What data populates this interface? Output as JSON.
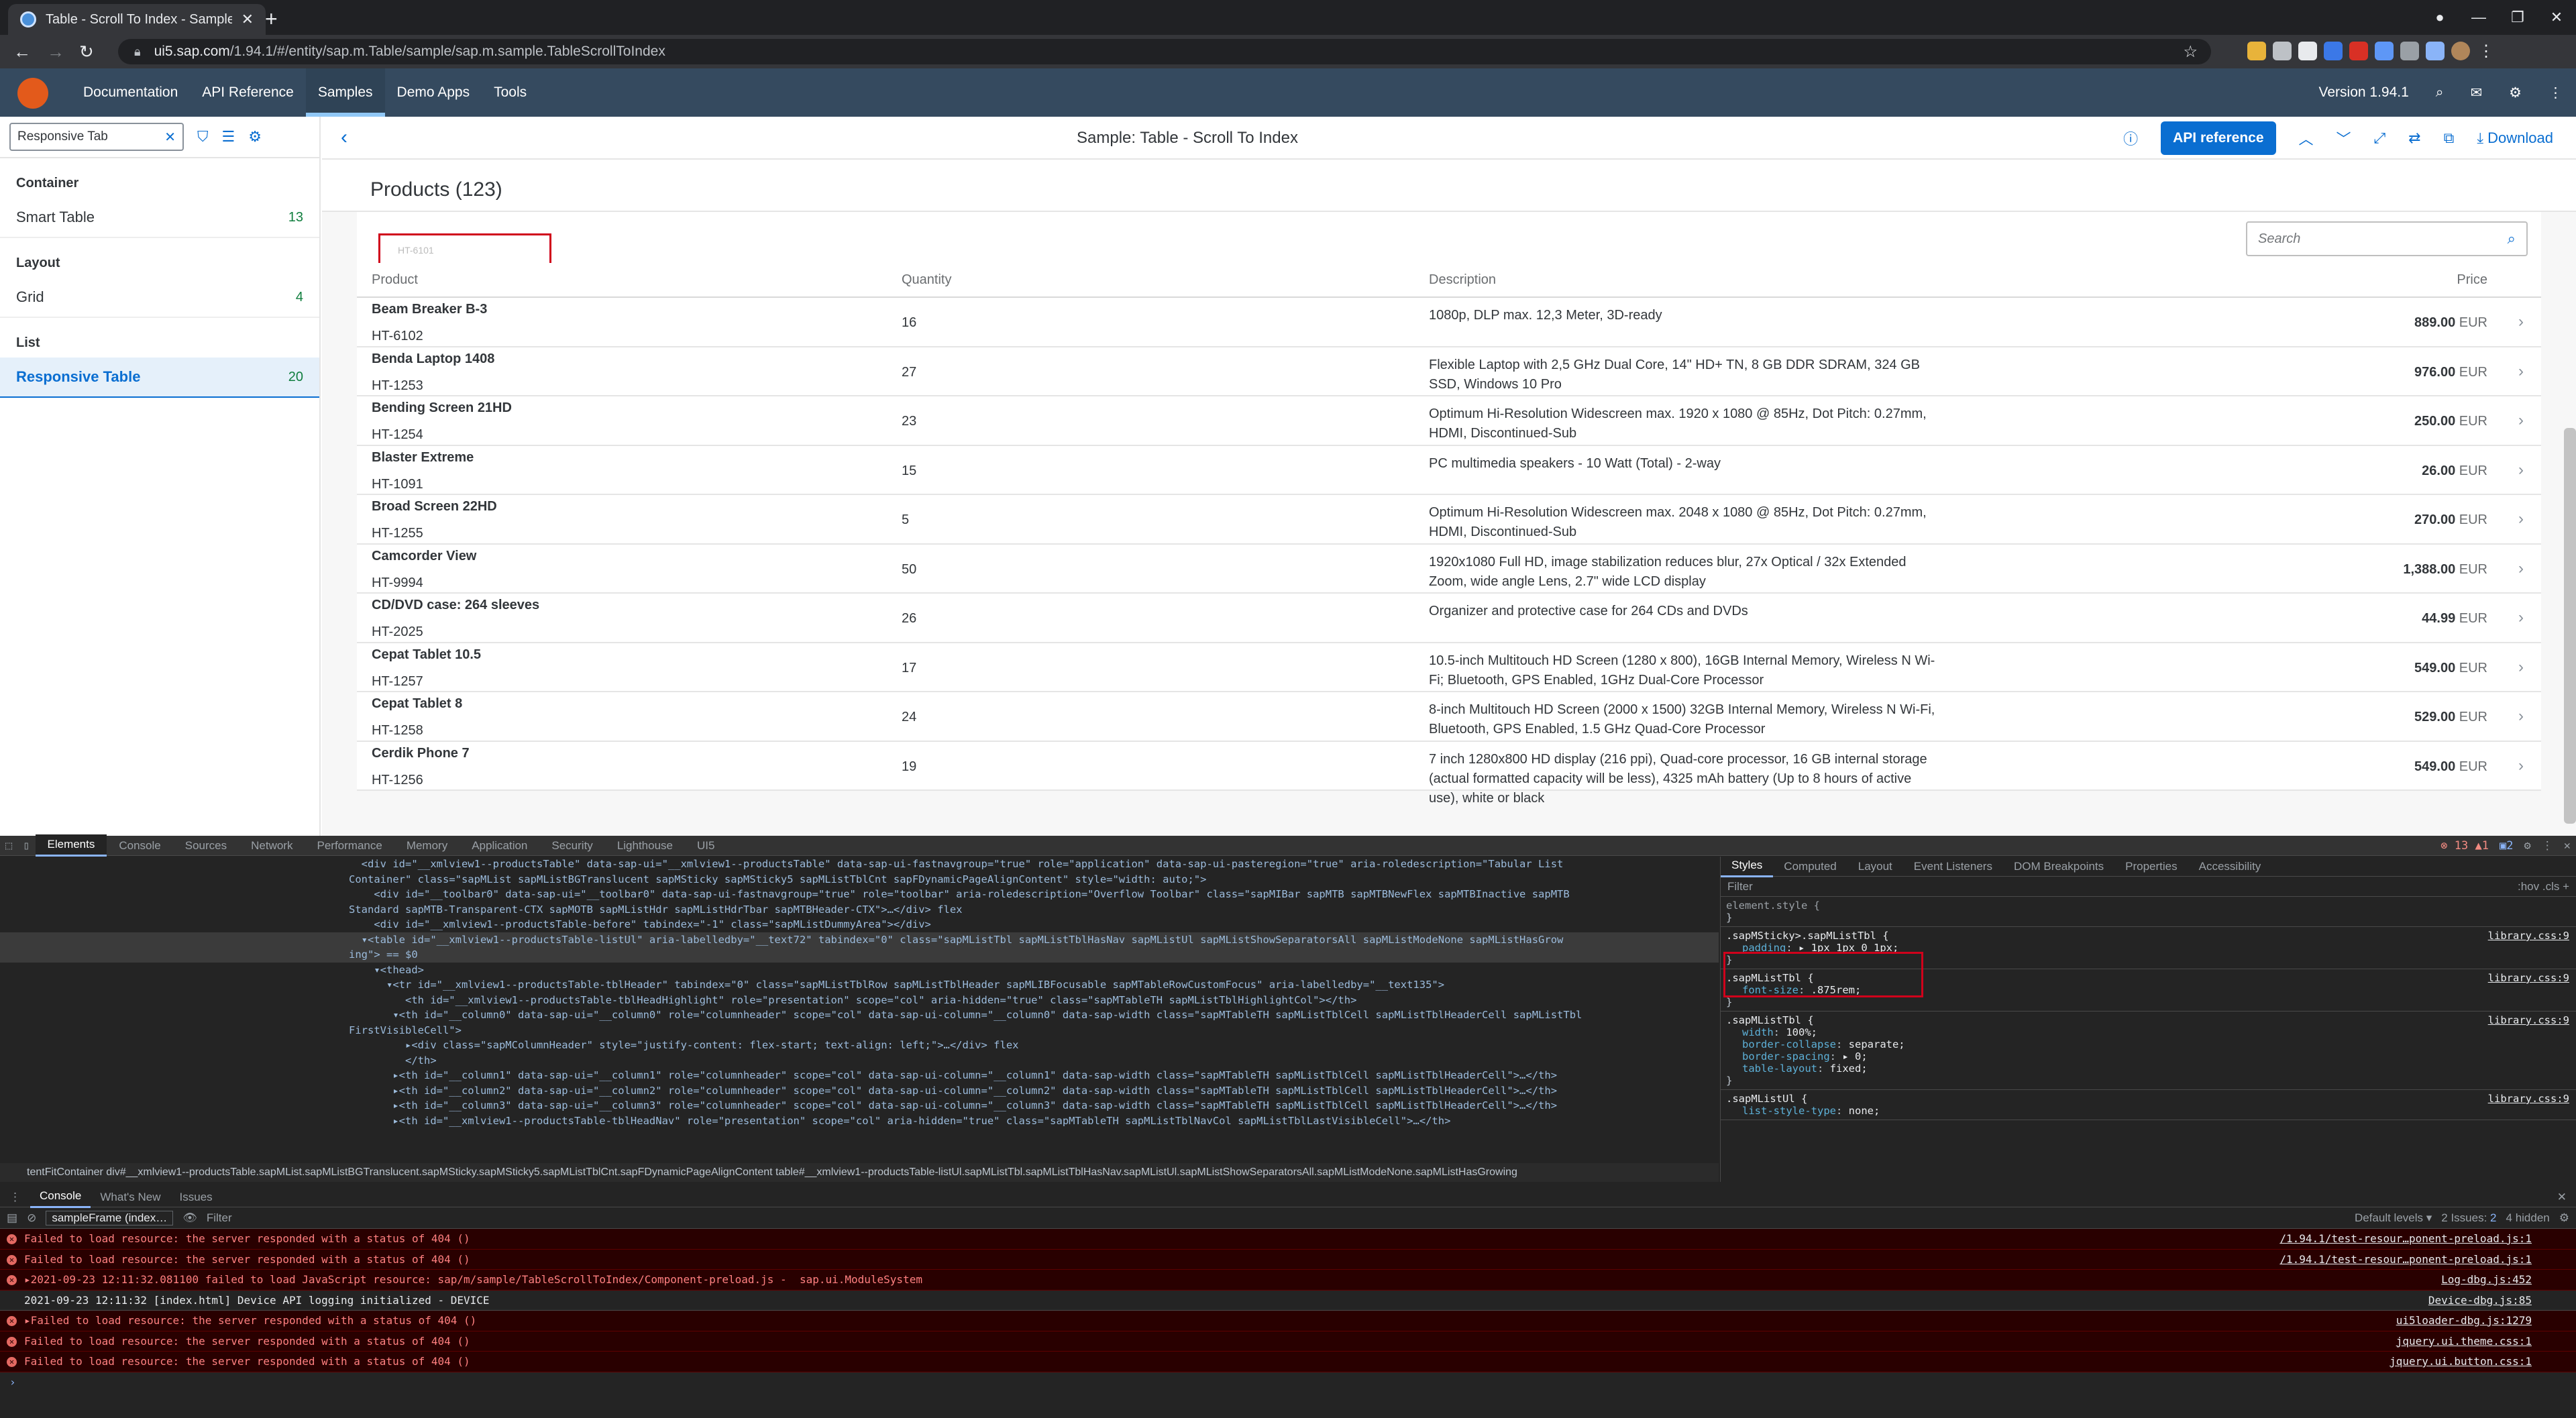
{
  "browser": {
    "tab_title": "Table - Scroll To Index - Samples",
    "tab_close": "✕",
    "new_tab": "+",
    "url_host": "ui5.sap.com",
    "url_path": "/1.94.1/#/entity/sap.m.Table/sample/sap.m.sample.TableScrollToIndex"
  },
  "shell": {
    "nav": [
      "Documentation",
      "API Reference",
      "Samples",
      "Demo Apps",
      "Tools"
    ],
    "selected": "Samples",
    "version": "Version 1.94.1"
  },
  "left": {
    "search_value": "Responsive Tab",
    "groups": [
      {
        "title": "Container",
        "items": [
          {
            "label": "Smart Table",
            "count": "13"
          }
        ]
      },
      {
        "title": "Layout",
        "items": [
          {
            "label": "Grid",
            "count": "4"
          }
        ]
      },
      {
        "title": "List",
        "items": [
          {
            "label": "Responsive Table",
            "count": "20"
          }
        ]
      }
    ]
  },
  "header": {
    "title": "Sample: Table - Scroll To Index",
    "api_reference": "API reference",
    "download": "Download"
  },
  "products": {
    "title": "Products (123)",
    "search_placeholder": "Search",
    "cut_label": "HT-6101",
    "columns": [
      "Product",
      "Quantity",
      "Description",
      "Price"
    ],
    "currency": "EUR",
    "rows": [
      {
        "name": "Beam Breaker B-3",
        "id": "HT-6102",
        "qty": "16",
        "desc": "1080p, DLP max. 12,3 Meter, 3D-ready",
        "price": "889.00"
      },
      {
        "name": "Benda Laptop 1408",
        "id": "HT-1253",
        "qty": "27",
        "desc": "Flexible Laptop with 2,5 GHz Dual Core, 14\" HD+ TN, 8 GB DDR SDRAM, 324 GB SSD, Windows 10 Pro",
        "price": "976.00"
      },
      {
        "name": "Bending Screen 21HD",
        "id": "HT-1254",
        "qty": "23",
        "desc": "Optimum Hi-Resolution Widescreen max. 1920 x 1080 @ 85Hz, Dot Pitch: 0.27mm, HDMI, Discontinued-Sub",
        "price": "250.00"
      },
      {
        "name": "Blaster Extreme",
        "id": "HT-1091",
        "qty": "15",
        "desc": "PC multimedia speakers - 10 Watt (Total) - 2-way",
        "price": "26.00"
      },
      {
        "name": "Broad Screen 22HD",
        "id": "HT-1255",
        "qty": "5",
        "desc": "Optimum Hi-Resolution Widescreen max. 2048 x 1080 @ 85Hz, Dot Pitch: 0.27mm, HDMI, Discontinued-Sub",
        "price": "270.00"
      },
      {
        "name": "Camcorder View",
        "id": "HT-9994",
        "qty": "50",
        "desc": "1920x1080 Full HD, image stabilization reduces blur, 27x Optical / 32x Extended Zoom, wide angle Lens, 2.7\" wide LCD display",
        "price": "1,388.00"
      },
      {
        "name": "CD/DVD case: 264 sleeves",
        "id": "HT-2025",
        "qty": "26",
        "desc": "Organizer and protective case for 264 CDs and DVDs",
        "price": "44.99"
      },
      {
        "name": "Cepat Tablet 10.5",
        "id": "HT-1257",
        "qty": "17",
        "desc": "10.5-inch Multitouch HD Screen (1280 x 800), 16GB Internal Memory, Wireless N Wi-Fi; Bluetooth, GPS Enabled, 1GHz Dual-Core Processor",
        "price": "549.00"
      },
      {
        "name": "Cepat Tablet 8",
        "id": "HT-1258",
        "qty": "24",
        "desc": "8-inch Multitouch HD Screen (2000 x 1500) 32GB Internal Memory, Wireless N Wi-Fi, Bluetooth, GPS Enabled, 1.5 GHz Quad-Core Processor",
        "price": "529.00"
      },
      {
        "name": "Cerdik Phone 7",
        "id": "HT-1256",
        "qty": "19",
        "desc": "7 inch 1280x800 HD display (216 ppi), Quad-core processor, 16 GB internal storage (actual formatted capacity will be less), 4325 mAh battery (Up to 8 hours of active use), white or black",
        "price": "549.00"
      }
    ]
  },
  "devtools": {
    "tabs": [
      "Elements",
      "Console",
      "Sources",
      "Network",
      "Performance",
      "Memory",
      "Application",
      "Security",
      "Lighthouse",
      "UI5"
    ],
    "selected_tab": "Elements",
    "errors": "13",
    "warnings": "1",
    "issues": "2",
    "dom_lines": [
      "  <div id=\"__xmlview1--productsTable\" data-sap-ui=\"__xmlview1--productsTable\" data-sap-ui-fastnavgroup=\"true\" role=\"application\" data-sap-ui-pasteregion=\"true\" aria-roledescription=\"Tabular List",
      "Container\" class=\"sapMList sapMListBGTranslucent sapMSticky sapMSticky5 sapMListTblCnt sapFDynamicPageAlignContent\" style=\"width: auto;\">",
      "    <div id=\"__toolbar0\" data-sap-ui=\"__toolbar0\" data-sap-ui-fastnavgroup=\"true\" role=\"toolbar\" aria-roledescription=\"Overflow Toolbar\" class=\"sapMIBar sapMTB sapMTBNewFlex sapMTBInactive sapMTB",
      "Standard sapMTB-Transparent-CTX sapMOTB sapMListHdr sapMListHdrTbar sapMTBHeader-CTX\">…</div> flex",
      "    <div id=\"__xmlview1--productsTable-before\" tabindex=\"-1\" class=\"sapMListDummyArea\"></div>",
      "  ▾<table id=\"__xmlview1--productsTable-listUl\" aria-labelledby=\"__text72\" tabindex=\"0\" class=\"sapMListTbl sapMListTblHasNav sapMListUl sapMListShowSeparatorsAll sapMListModeNone sapMListHasGrow",
      "ing\"> == $0",
      "    ▾<thead>",
      "      ▾<tr id=\"__xmlview1--productsTable-tblHeader\" tabindex=\"0\" class=\"sapMListTblRow sapMListTblHeader sapMLIBFocusable sapMTableRowCustomFocus\" aria-labelledby=\"__text135\">",
      "         <th id=\"__xmlview1--productsTable-tblHeadHighlight\" role=\"presentation\" scope=\"col\" aria-hidden=\"true\" class=\"sapMTableTH sapMListTblHighlightCol\"></th>",
      "       ▾<th id=\"__column0\" data-sap-ui=\"__column0\" role=\"columnheader\" scope=\"col\" data-sap-ui-column=\"__column0\" data-sap-width class=\"sapMTableTH sapMListTblCell sapMListTblHeaderCell sapMListTbl",
      "FirstVisibleCell\">",
      "         ▸<div class=\"sapMColumnHeader\" style=\"justify-content: flex-start; text-align: left;\">…</div> flex",
      "         </th>",
      "       ▸<th id=\"__column1\" data-sap-ui=\"__column1\" role=\"columnheader\" scope=\"col\" data-sap-ui-column=\"__column1\" data-sap-width class=\"sapMTableTH sapMListTblCell sapMListTblHeaderCell\">…</th>",
      "       ▸<th id=\"__column2\" data-sap-ui=\"__column2\" role=\"columnheader\" scope=\"col\" data-sap-ui-column=\"__column2\" data-sap-width class=\"sapMTableTH sapMListTblCell sapMListTblHeaderCell\">…</th>",
      "       ▸<th id=\"__column3\" data-sap-ui=\"__column3\" role=\"columnheader\" scope=\"col\" data-sap-ui-column=\"__column3\" data-sap-width class=\"sapMTableTH sapMListTblCell sapMListTblHeaderCell\">…</th>",
      "       ▸<th id=\"__xmlview1--productsTable-tblHeadNav\" role=\"presentation\" scope=\"col\" aria-hidden=\"true\" class=\"sapMTableTH sapMListTblNavCol sapMListTblLastVisibleCell\">…</th>"
    ],
    "crumbs": "tentFitContainer   div#__xmlview1--productsTable.sapMList.sapMListBGTranslucent.sapMSticky.sapMSticky5.sapMListTblCnt.sapFDynamicPageAlignContent   table#__xmlview1--productsTable-listUl.sapMListTbl.sapMListTblHasNav.sapMListUl.sapMListShowSeparatorsAll.sapMListModeNone.sapMListHasGrowing",
    "styles_tabs": [
      "Styles",
      "Computed",
      "Layout",
      "Event Listeners",
      "DOM Breakpoints",
      "Properties",
      "Accessibility"
    ],
    "filter_label": "Filter",
    "hov_cls": ":hov  .cls  +",
    "rules": [
      {
        "selector": "element.style {",
        "props": [],
        "close": "}",
        "src": ""
      },
      {
        "selector": ".sapMSticky>.sapMListTbl {",
        "props": [
          [
            "padding",
            "▸ 1px 1px 0 1px;"
          ]
        ],
        "close": "}",
        "src": "library.css:9"
      },
      {
        "selector": ".sapMListTbl {",
        "props": [
          [
            "font-size",
            ".875rem;"
          ]
        ],
        "close": "}",
        "src": "library.css:9"
      },
      {
        "selector": ".sapMListTbl {",
        "props": [
          [
            "width",
            "100%;"
          ],
          [
            "border-collapse",
            "separate;"
          ],
          [
            "border-spacing",
            "▸ 0;"
          ],
          [
            "table-layout",
            "fixed;"
          ]
        ],
        "close": "}",
        "src": "library.css:9"
      },
      {
        "selector": ".sapMListUl {",
        "props": [
          [
            "list-style-type",
            "none;"
          ]
        ],
        "close": "",
        "src": "library.css:9"
      }
    ],
    "console_tabs": [
      "Console",
      "What's New",
      "Issues"
    ],
    "context": "sampleFrame (index…",
    "console_filter": "Filter",
    "levels": "Default levels ▾",
    "issues_label": "2 Issues:",
    "hidden": "4 hidden",
    "messages": [
      {
        "type": "err",
        "text": "Failed to load resource: the server responded with a status of 404 ()",
        "src": "/1.94.1/test-resour…ponent-preload.js:1"
      },
      {
        "type": "err",
        "text": "Failed to load resource: the server responded with a status of 404 ()",
        "src": "/1.94.1/test-resour…ponent-preload.js:1"
      },
      {
        "type": "err",
        "text": "▸2021-09-23 12:11:32.081100 failed to load JavaScript resource: sap/m/sample/TableScrollToIndex/Component-preload.js -  sap.ui.ModuleSystem",
        "src": "Log-dbg.js:452"
      },
      {
        "type": "log",
        "text": "2021-09-23 12:11:32 [index.html] Device API logging initialized - DEVICE",
        "src": "Device-dbg.js:85"
      },
      {
        "type": "err",
        "text": "▸Failed to load resource: the server responded with a status of 404 ()",
        "src": "ui5loader-dbg.js:1279"
      },
      {
        "type": "err",
        "text": "Failed to load resource: the server responded with a status of 404 ()",
        "src": "jquery.ui.theme.css:1"
      },
      {
        "type": "err",
        "text": "Failed to load resource: the server responded with a status of 404 ()",
        "src": "jquery.ui.button.css:1"
      }
    ]
  }
}
